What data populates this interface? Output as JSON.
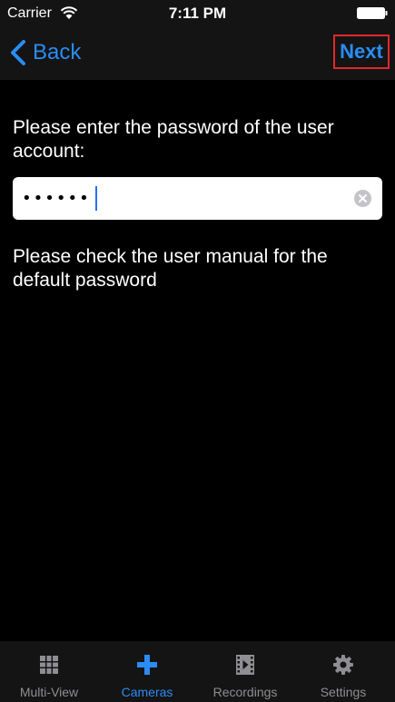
{
  "status_bar": {
    "carrier": "Carrier",
    "time": "7:11 PM"
  },
  "nav": {
    "back_label": "Back",
    "next_label": "Next"
  },
  "main": {
    "prompt": "Please enter the password of the user account:",
    "password_value": "••••••",
    "hint": "Please check the user manual for the default password"
  },
  "tabbar": {
    "tabs": [
      {
        "label": "Multi-View",
        "icon": "grid-icon",
        "active": false
      },
      {
        "label": "Cameras",
        "icon": "plus-icon",
        "active": true
      },
      {
        "label": "Recordings",
        "icon": "film-icon",
        "active": false
      },
      {
        "label": "Settings",
        "icon": "gear-icon",
        "active": false
      }
    ]
  },
  "colors": {
    "accent": "#2a8cf4",
    "highlight_border": "#e0282c",
    "bar_bg": "#141414",
    "inactive_tab": "#8e8e93"
  }
}
